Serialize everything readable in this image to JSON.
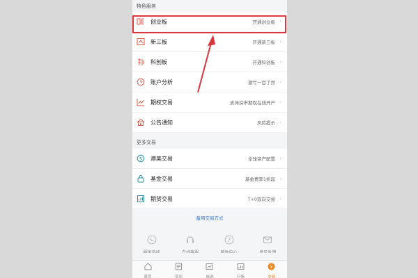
{
  "sections": {
    "featured_title": "特色服务",
    "more_title": "更多交易"
  },
  "featured": [
    {
      "label": "创业板",
      "desc": "开通创业板",
      "icon": "chinext-icon"
    },
    {
      "label": "新三板",
      "desc": "开通新三板",
      "icon": "neeq-icon"
    },
    {
      "label": "科创板",
      "desc": "开通科创板",
      "icon": "star-market-icon"
    },
    {
      "label": "账户分析",
      "desc": "激亏一目了然",
      "icon": "clock-icon"
    },
    {
      "label": "期权交易",
      "desc": "支持深市期权在线开户",
      "icon": "chart-icon"
    },
    {
      "label": "公告通知",
      "desc": "风险提示",
      "icon": "house-icon"
    }
  ],
  "more": [
    {
      "label": "港美交易",
      "desc": "全球资产配置",
      "icon": "dollar-icon"
    },
    {
      "label": "基金交易",
      "desc": "基金费率1折起",
      "icon": "lock-icon"
    },
    {
      "label": "期货交易",
      "desc": "T+0双向交易",
      "icon": "futures-icon"
    }
  ],
  "backup_link": "备用交易方式",
  "quick_actions": [
    {
      "label": "服务热线",
      "icon": "phone-icon"
    },
    {
      "label": "在线客服",
      "icon": "headset-icon"
    },
    {
      "label": "帮助中心",
      "icon": "help-icon"
    },
    {
      "label": "意见反馈",
      "icon": "mail-icon"
    }
  ],
  "tabs": [
    {
      "label": "首页",
      "icon": "home-icon"
    },
    {
      "label": "资讯",
      "icon": "news-icon"
    },
    {
      "label": "自选",
      "icon": "watchlist-icon"
    },
    {
      "label": "行情",
      "icon": "market-icon"
    },
    {
      "label": "交易",
      "icon": "trade-icon"
    }
  ],
  "colors": {
    "accent": "#f08519",
    "highlight": "#d9363e",
    "link": "#3a7bd5"
  }
}
